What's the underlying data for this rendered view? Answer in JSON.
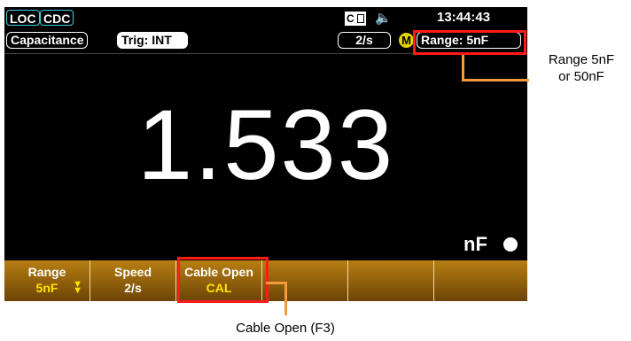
{
  "status": {
    "loc": "LOC",
    "cdc": "CDC",
    "ce_icon": "CE-panel-icon",
    "speaker_icon": "speaker-icon",
    "time": "13:44:43"
  },
  "info": {
    "function": "Capacitance",
    "trigger": "Trig: INT",
    "rate": "2/s",
    "math_badge": "M",
    "range": "Range:  5nF"
  },
  "display": {
    "value": "1.533",
    "unit": "nF"
  },
  "softkeys": [
    {
      "label": "Range",
      "value": "5nF"
    },
    {
      "label": "Speed",
      "value": "2/s"
    },
    {
      "label": "Cable Open",
      "value": "CAL"
    },
    {
      "label": "",
      "value": ""
    },
    {
      "label": "",
      "value": ""
    },
    {
      "label": "",
      "value": ""
    }
  ],
  "annotations": {
    "range_note_1": "Range 5nF",
    "range_note_2": "or 50nF",
    "cable_note": "Cable Open (F3)"
  },
  "colors": {
    "annotation_box": "#ff1a1a",
    "leader_line": "#f59a3c",
    "softkey_value": "#ffe400"
  }
}
